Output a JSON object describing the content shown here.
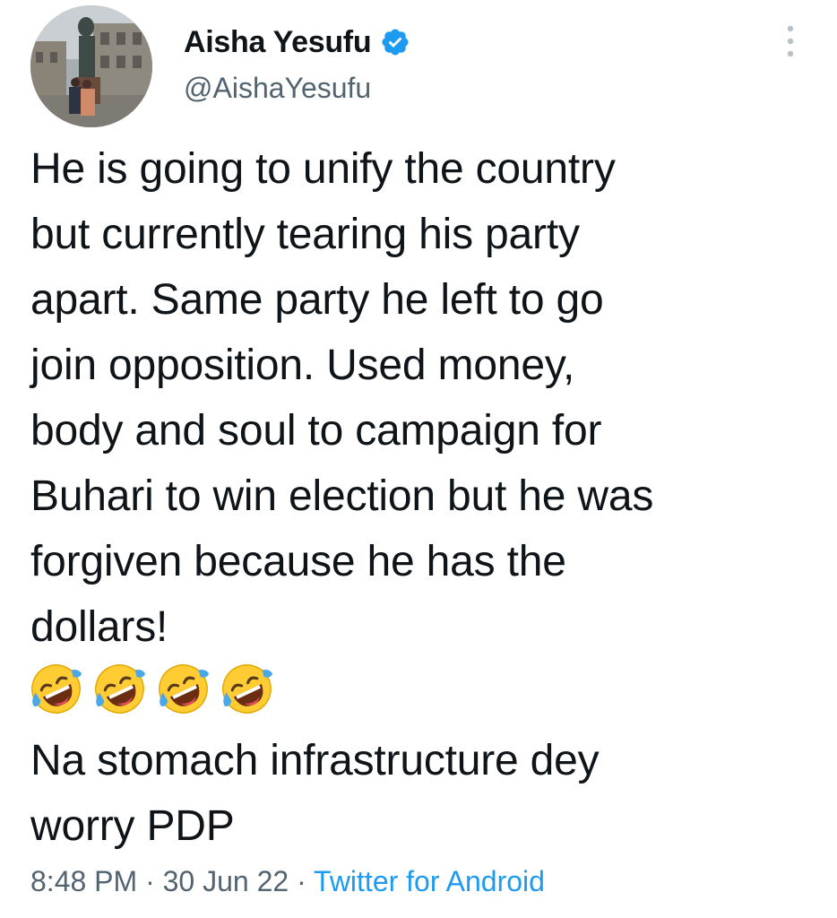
{
  "author": {
    "name": "Aisha Yesufu",
    "handle": "@AishaYesufu",
    "verified": true,
    "avatar_icon": "profile-photo"
  },
  "tweet": {
    "text": "He is going to unify the country\nbut currently tearing his party\napart. Same party he left to go\njoin opposition. Used money,\nbody and soul to campaign for\nBuhari to win election but he was\nforgiven because he has the\ndollars!",
    "emojis": [
      "🤣",
      "🤣",
      "🤣",
      "🤣"
    ],
    "text_2": "Na stomach infrastructure dey\nworry PDP"
  },
  "meta": {
    "time": "8:48 PM",
    "separator": "·",
    "date": "30 Jun 22",
    "source": "Twitter for Android"
  },
  "colors": {
    "accent": "#1d9bf0",
    "text": "#0f1419",
    "muted": "#536471"
  },
  "icons": {
    "verified": "verified-badge-icon",
    "more": "more-vertical-icon",
    "emoji": "rolling-on-floor-laughing-emoji"
  }
}
